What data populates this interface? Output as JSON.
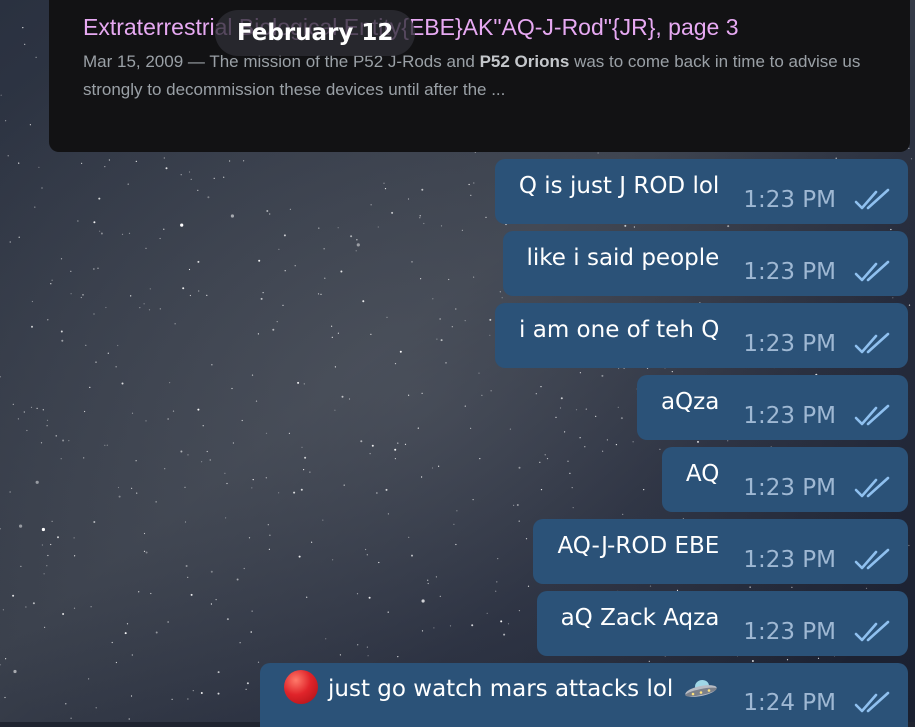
{
  "link_preview": {
    "title": "Extraterrestrial Biological Entity{EBE}AK\"AQ-J-Rod\"{JR}, page 3",
    "date": "Mar 15, 2009",
    "snippet_before": " — The mission of the P52 J-Rods and ",
    "snippet_bold": "P52 Orions",
    "snippet_after": " was to come back in time to advise us strongly to decommission these devices until after the ..."
  },
  "date_separator": "February 12",
  "messages": [
    {
      "text": "Q is just J ROD lol",
      "time": "1:23 PM",
      "status": "read"
    },
    {
      "text": "like i said people",
      "time": "1:23 PM",
      "status": "read"
    },
    {
      "text": "i am one of teh Q",
      "time": "1:23 PM",
      "status": "read"
    },
    {
      "text": "aQza",
      "time": "1:23 PM",
      "status": "read"
    },
    {
      "text": "AQ",
      "time": "1:23 PM",
      "status": "read"
    },
    {
      "text": "AQ-J-ROD EBE",
      "time": "1:23 PM",
      "status": "read"
    },
    {
      "text": "aQ Zack Aqza",
      "time": "1:23 PM",
      "status": "read"
    },
    {
      "text": "just go watch mars attacks lol",
      "time": "1:24 PM",
      "status": "read",
      "prefix_emoji": "red-circle-icon",
      "suffix_emoji": "flying-saucer-icon"
    }
  ],
  "colors": {
    "bubble": "#2b5278",
    "time": "#9fb8d3",
    "link_title": "#e7a9f2",
    "preview_bg": "#121214"
  }
}
